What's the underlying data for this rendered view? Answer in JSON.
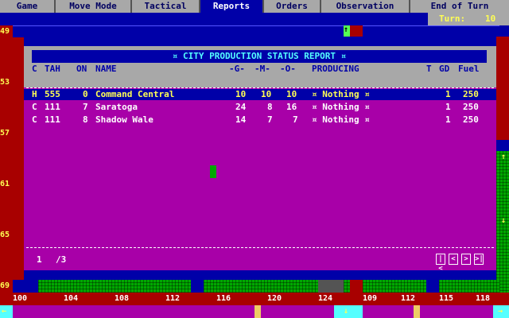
{
  "menu": {
    "items": [
      "Game",
      "Move Mode",
      "Tactical",
      "Reports",
      "Orders",
      "Observation",
      "End of Turn"
    ],
    "active_index": 3
  },
  "turn": {
    "label": "Turn:",
    "value": "10"
  },
  "map": {
    "row_coords": [
      "49",
      "53",
      "57",
      "61",
      "65",
      "69"
    ],
    "col_coords": [
      "100",
      "104",
      "108",
      "112",
      "116",
      "120",
      "124",
      "109",
      "112",
      "115",
      "118"
    ]
  },
  "report": {
    "title": "¤ CITY PRODUCTION STATUS REPORT ¤",
    "headers": {
      "c": "C",
      "tah": "TAH",
      "on": "ON",
      "name": "NAME",
      "g": "-G-",
      "m": "-M-",
      "o": "-O-",
      "producing": "PRODUCING",
      "t": "T",
      "gd": "GD",
      "fuel": "Fuel"
    },
    "rows": [
      {
        "c": "H",
        "tah": "555",
        "on": "0",
        "name": "Command Central",
        "g": "10",
        "m": "10",
        "o": "10",
        "producing": "¤ Nothing ¤",
        "t": "",
        "gd": "1",
        "fuel": "250"
      },
      {
        "c": "C",
        "tah": "111",
        "on": "7",
        "name": "Saratoga",
        "g": "24",
        "m": "8",
        "o": "16",
        "producing": "¤ Nothing ¤",
        "t": "",
        "gd": "1",
        "fuel": "250"
      },
      {
        "c": "C",
        "tah": "111",
        "on": "8",
        "name": "Shadow Wale",
        "g": "14",
        "m": "7",
        "o": "7",
        "producing": "¤ Nothing ¤",
        "t": "",
        "gd": "1",
        "fuel": "250"
      }
    ],
    "page": {
      "current": "1",
      "total": "/3"
    },
    "nav": [
      "|<",
      "<",
      ">",
      ">|"
    ]
  },
  "colors": {
    "menu_bg": "#a8a8a8",
    "menu_active": "#0000a8",
    "panel": "#a800a8",
    "map_red": "#a80000",
    "map_green": "#00a800",
    "map_blue": "#0000a8",
    "highlight": "#ffff54"
  }
}
